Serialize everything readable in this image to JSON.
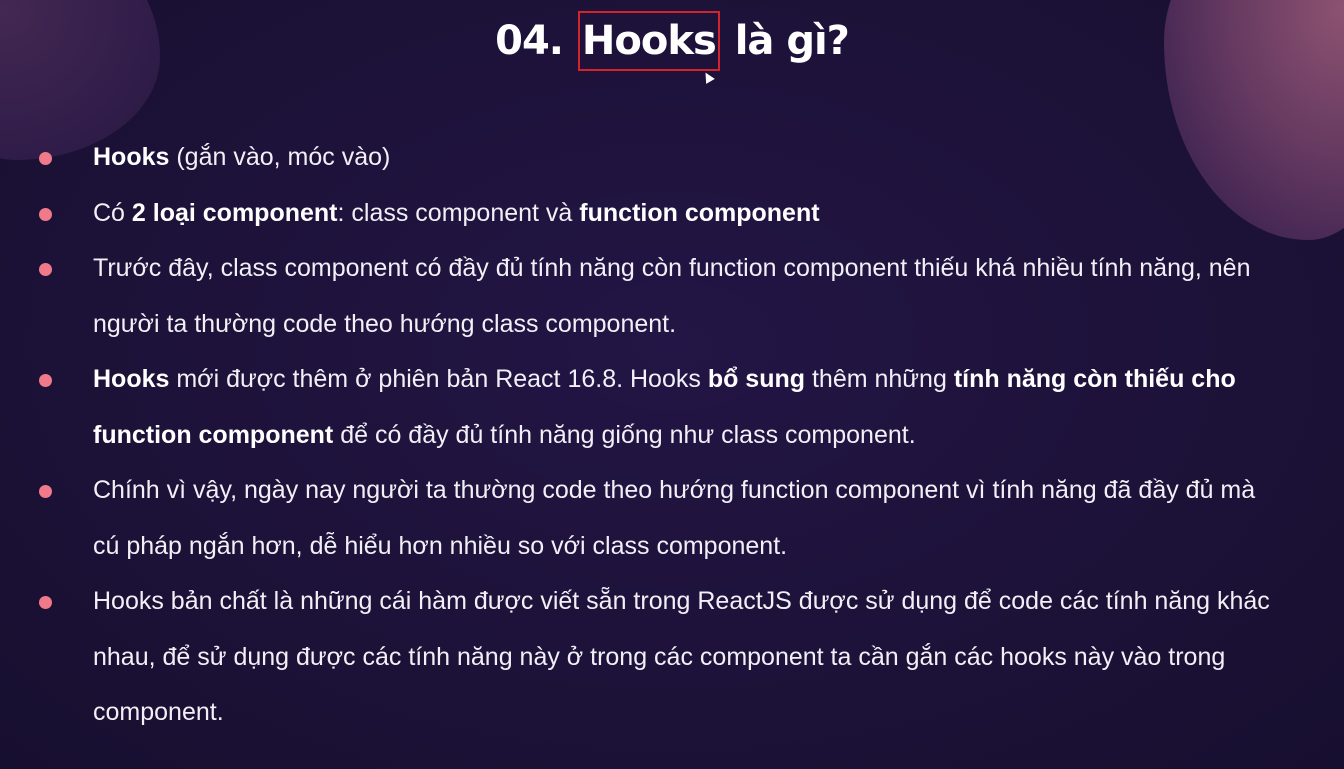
{
  "title": {
    "prefix": "04.",
    "highlighted": "Hooks",
    "suffix": "là gì?"
  },
  "bullets": [
    {
      "parts": [
        {
          "text": "Hooks",
          "bold": true
        },
        {
          "text": " (gắn vào, móc vào)",
          "bold": false
        }
      ]
    },
    {
      "parts": [
        {
          "text": "Có ",
          "bold": false
        },
        {
          "text": "2 loại component",
          "bold": true
        },
        {
          "text": ": class component và ",
          "bold": false
        },
        {
          "text": "function component",
          "bold": true
        }
      ]
    },
    {
      "parts": [
        {
          "text": "Trước đây, class component có đầy đủ tính năng còn function component thiếu khá nhiều tính năng, nên người ta thường code theo hướng class component.",
          "bold": false
        }
      ]
    },
    {
      "parts": [
        {
          "text": "Hooks",
          "bold": true
        },
        {
          "text": " mới được thêm ở phiên bản React 16.8. Hooks ",
          "bold": false
        },
        {
          "text": "bổ sung",
          "bold": true
        },
        {
          "text": " thêm những ",
          "bold": false
        },
        {
          "text": "tính năng còn thiếu cho function component",
          "bold": true
        },
        {
          "text": " để có đầy đủ tính năng giống như class component.",
          "bold": false
        }
      ]
    },
    {
      "parts": [
        {
          "text": "Chính vì vậy, ngày nay người ta thường code theo hướng function component vì tính năng đã đầy đủ mà cú pháp ngắn hơn, dễ hiểu hơn nhiều so với class component.",
          "bold": false
        }
      ]
    },
    {
      "parts": [
        {
          "text": "Hooks bản chất là những cái hàm được viết sẵn trong ReactJS được sử dụng để code các tính năng khác nhau, để sử dụng được các tính năng này ở trong các component ta cần gắn các hooks này vào trong component.",
          "bold": false
        }
      ]
    }
  ],
  "colors": {
    "background": "#1d1239",
    "bullet_dot": "#f07a8a",
    "highlight_box": "#d4242b",
    "text": "#ffffff"
  }
}
